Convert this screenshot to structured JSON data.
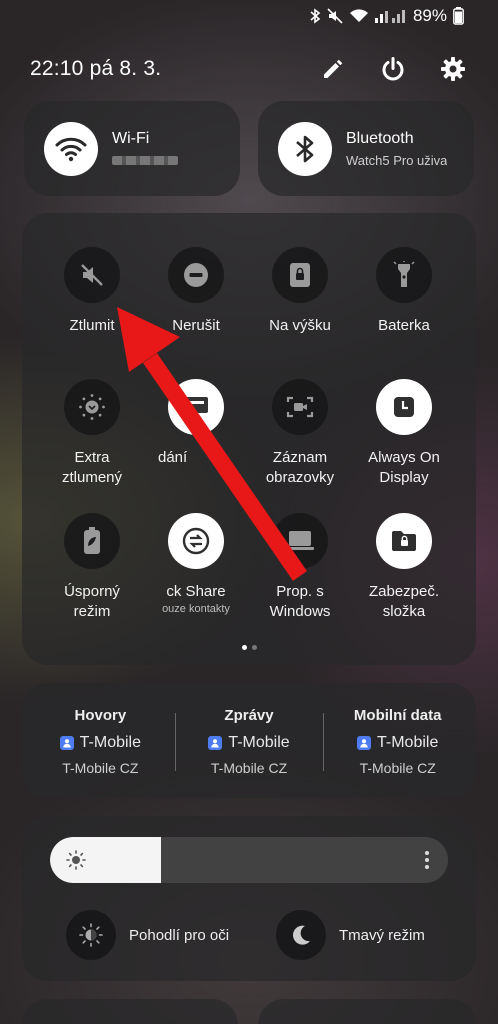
{
  "status": {
    "battery": "89%"
  },
  "header": {
    "datetime": "22:10  pá 8. 3."
  },
  "big_tiles": [
    {
      "title": "Wi-Fi",
      "sub": ""
    },
    {
      "title": "Bluetooth",
      "sub": "Watch5 Pro uživa"
    }
  ],
  "tiles": [
    {
      "label": "Ztlumit",
      "sub": ""
    },
    {
      "label": "Nerušit",
      "sub": ""
    },
    {
      "label": "Na výšku",
      "sub": ""
    },
    {
      "label": "Baterka",
      "sub": ""
    },
    {
      "label": "Extra\nztlumený",
      "sub": ""
    },
    {
      "label": "dání",
      "sub": ""
    },
    {
      "label": "Záznam\nobrazovky",
      "sub": ""
    },
    {
      "label": "Always On\nDisplay",
      "sub": ""
    },
    {
      "label": "Úsporný\nrežim",
      "sub": ""
    },
    {
      "label": "ck Share",
      "sub": "ouze kontakty"
    },
    {
      "label": "Prop. s\nWindows",
      "sub": ""
    },
    {
      "label": "Zabezpeč.\nsložka",
      "sub": ""
    }
  ],
  "sim": [
    {
      "title": "Hovory",
      "carrier": "T-Mobile",
      "network": "T-Mobile CZ"
    },
    {
      "title": "Zprávy",
      "carrier": "T-Mobile",
      "network": "T-Mobile CZ"
    },
    {
      "title": "Mobilní data",
      "carrier": "T-Mobile",
      "network": "T-Mobile CZ"
    }
  ],
  "brightness": {
    "level_percent": 28
  },
  "toggles": [
    {
      "label": "Pohodlí pro oči"
    },
    {
      "label": "Tmavý režim"
    }
  ],
  "colors": {
    "arrow": "#e81818",
    "sim_badge": "#4d7df0"
  },
  "icons": [
    "muted-icon",
    "dnd-icon",
    "portrait-lock-icon",
    "flashlight-icon",
    "extra-dim-icon",
    "cast-icon",
    "screen-record-icon",
    "always-on-display-icon",
    "power-saving-icon",
    "quick-share-icon",
    "link-windows-icon",
    "secure-folder-icon"
  ]
}
